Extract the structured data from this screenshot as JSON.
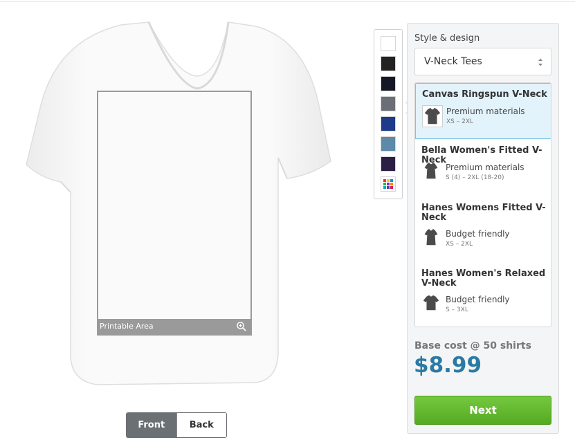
{
  "preview": {
    "printable_label": "Printable Area",
    "zoom_icon": "zoom-in-icon",
    "views": [
      {
        "label": "Front",
        "active": true
      },
      {
        "label": "Back",
        "active": false
      }
    ]
  },
  "palette": {
    "colors": [
      "#ffffff",
      "#222222",
      "#141826",
      "#6b6e76",
      "#1e3a8a",
      "#5c8aa8",
      "#2b1f45"
    ],
    "multi_icon": "color-grid-icon",
    "multi_colors": [
      "#e53935",
      "#fbc02d",
      "#1e88e5",
      "#43a047",
      "#8e24aa",
      "#fb8c00",
      "#00acc1",
      "#3949ab",
      "#d81b60"
    ]
  },
  "panel": {
    "title": "Style & design",
    "select_value": "V-Neck Tees",
    "products": [
      {
        "name": "Canvas Ringspun V-Neck",
        "desc": "Premium materials",
        "sizes": "XS – 2XL",
        "selected": true
      },
      {
        "name": "Bella Women's Fitted V-Neck",
        "desc": "Premium materials",
        "sizes": "S (4) – 2XL (18-20)",
        "selected": false
      },
      {
        "name": "Hanes Womens Fitted V-Neck",
        "desc": "Budget friendly",
        "sizes": "XS – 2XL",
        "selected": false
      },
      {
        "name": "Hanes Women's Relaxed V-Neck",
        "desc": "Budget friendly",
        "sizes": "S – 3XL",
        "selected": false
      }
    ],
    "cost_label": "Base cost @ 50 shirts",
    "price": "$8.99",
    "next_label": "Next"
  },
  "colors": {
    "accent_price": "#2b7aa3",
    "next_green": "#5bb12a",
    "selected_bg": "#e3f3fb"
  }
}
